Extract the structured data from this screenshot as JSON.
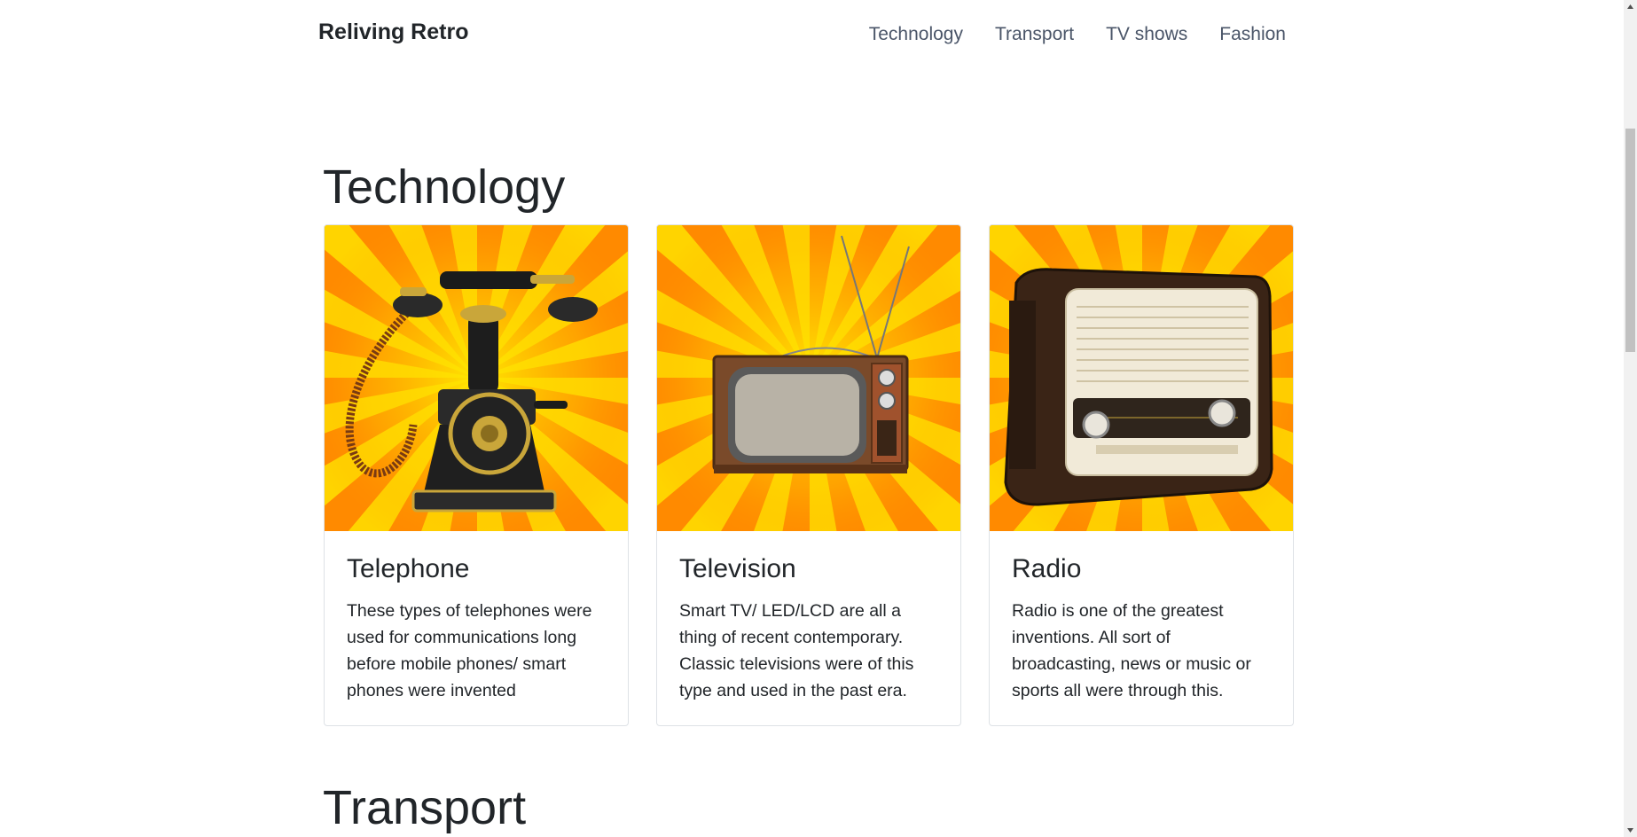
{
  "navbar": {
    "brand": "Reliving Retro",
    "links": [
      "Technology",
      "Transport",
      "TV shows",
      "Fashion"
    ]
  },
  "sections": {
    "technology": {
      "title": "Technology",
      "cards": [
        {
          "title": "Telephone",
          "text": "These types of telephones were used for communications long before mobile phones/ smart phones were invented"
        },
        {
          "title": "Television",
          "text": "Smart TV/ LED/LCD are all a thing of recent contemporary. Classic televisions were of this type and used in the past era."
        },
        {
          "title": "Radio",
          "text": "Radio is one of the greatest inventions. All sort of broadcasting, news or music or sports all were through this."
        }
      ]
    },
    "transport": {
      "title": "Transport"
    }
  },
  "colors": {
    "burst_orange": "#ff8a00",
    "burst_yellow": "#ffd400",
    "nav_link": "#4a5568"
  }
}
